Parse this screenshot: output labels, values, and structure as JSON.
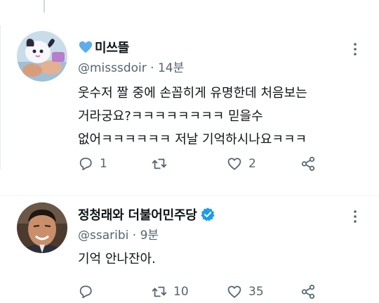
{
  "colors": {
    "text": "#0f1419",
    "secondary": "#536471",
    "verified": "#1d9bf0",
    "heart_emoji": "#5dadec"
  },
  "tweets": [
    {
      "display_name": "미쓰뜰",
      "name_prefix_icon": "blue-heart-emoji",
      "meta": "@misssdoir · 14분",
      "text": "웃수저 짤 중에 손꼽히게 유명한데 처음보는\n거라궁요?ㅋㅋㅋㅋㅋㅋㅋㅋ 믿을수\n없어ㅋㅋㅋㅋㅋㅋ 저날 기억하시나요ㅋㅋㅋ",
      "reply_count": "1",
      "retweet_count": "",
      "like_count": "2"
    },
    {
      "display_name": "정청래와 더불어민주당",
      "verified": true,
      "meta": "@ssaribi · 9분",
      "text": "기억 안나잔아.",
      "reply_count": "",
      "retweet_count": "10",
      "like_count": "35"
    }
  ]
}
